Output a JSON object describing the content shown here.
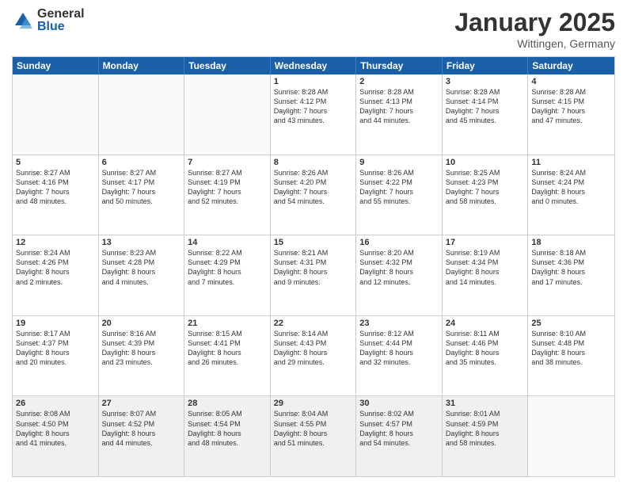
{
  "logo": {
    "general": "General",
    "blue": "Blue"
  },
  "title": "January 2025",
  "location": "Wittingen, Germany",
  "days": [
    "Sunday",
    "Monday",
    "Tuesday",
    "Wednesday",
    "Thursday",
    "Friday",
    "Saturday"
  ],
  "weeks": [
    [
      {
        "day": "",
        "info": ""
      },
      {
        "day": "",
        "info": ""
      },
      {
        "day": "",
        "info": ""
      },
      {
        "day": "1",
        "info": "Sunrise: 8:28 AM\nSunset: 4:12 PM\nDaylight: 7 hours\nand 43 minutes."
      },
      {
        "day": "2",
        "info": "Sunrise: 8:28 AM\nSunset: 4:13 PM\nDaylight: 7 hours\nand 44 minutes."
      },
      {
        "day": "3",
        "info": "Sunrise: 8:28 AM\nSunset: 4:14 PM\nDaylight: 7 hours\nand 45 minutes."
      },
      {
        "day": "4",
        "info": "Sunrise: 8:28 AM\nSunset: 4:15 PM\nDaylight: 7 hours\nand 47 minutes."
      }
    ],
    [
      {
        "day": "5",
        "info": "Sunrise: 8:27 AM\nSunset: 4:16 PM\nDaylight: 7 hours\nand 48 minutes."
      },
      {
        "day": "6",
        "info": "Sunrise: 8:27 AM\nSunset: 4:17 PM\nDaylight: 7 hours\nand 50 minutes."
      },
      {
        "day": "7",
        "info": "Sunrise: 8:27 AM\nSunset: 4:19 PM\nDaylight: 7 hours\nand 52 minutes."
      },
      {
        "day": "8",
        "info": "Sunrise: 8:26 AM\nSunset: 4:20 PM\nDaylight: 7 hours\nand 54 minutes."
      },
      {
        "day": "9",
        "info": "Sunrise: 8:26 AM\nSunset: 4:22 PM\nDaylight: 7 hours\nand 55 minutes."
      },
      {
        "day": "10",
        "info": "Sunrise: 8:25 AM\nSunset: 4:23 PM\nDaylight: 7 hours\nand 58 minutes."
      },
      {
        "day": "11",
        "info": "Sunrise: 8:24 AM\nSunset: 4:24 PM\nDaylight: 8 hours\nand 0 minutes."
      }
    ],
    [
      {
        "day": "12",
        "info": "Sunrise: 8:24 AM\nSunset: 4:26 PM\nDaylight: 8 hours\nand 2 minutes."
      },
      {
        "day": "13",
        "info": "Sunrise: 8:23 AM\nSunset: 4:28 PM\nDaylight: 8 hours\nand 4 minutes."
      },
      {
        "day": "14",
        "info": "Sunrise: 8:22 AM\nSunset: 4:29 PM\nDaylight: 8 hours\nand 7 minutes."
      },
      {
        "day": "15",
        "info": "Sunrise: 8:21 AM\nSunset: 4:31 PM\nDaylight: 8 hours\nand 9 minutes."
      },
      {
        "day": "16",
        "info": "Sunrise: 8:20 AM\nSunset: 4:32 PM\nDaylight: 8 hours\nand 12 minutes."
      },
      {
        "day": "17",
        "info": "Sunrise: 8:19 AM\nSunset: 4:34 PM\nDaylight: 8 hours\nand 14 minutes."
      },
      {
        "day": "18",
        "info": "Sunrise: 8:18 AM\nSunset: 4:36 PM\nDaylight: 8 hours\nand 17 minutes."
      }
    ],
    [
      {
        "day": "19",
        "info": "Sunrise: 8:17 AM\nSunset: 4:37 PM\nDaylight: 8 hours\nand 20 minutes."
      },
      {
        "day": "20",
        "info": "Sunrise: 8:16 AM\nSunset: 4:39 PM\nDaylight: 8 hours\nand 23 minutes."
      },
      {
        "day": "21",
        "info": "Sunrise: 8:15 AM\nSunset: 4:41 PM\nDaylight: 8 hours\nand 26 minutes."
      },
      {
        "day": "22",
        "info": "Sunrise: 8:14 AM\nSunset: 4:43 PM\nDaylight: 8 hours\nand 29 minutes."
      },
      {
        "day": "23",
        "info": "Sunrise: 8:12 AM\nSunset: 4:44 PM\nDaylight: 8 hours\nand 32 minutes."
      },
      {
        "day": "24",
        "info": "Sunrise: 8:11 AM\nSunset: 4:46 PM\nDaylight: 8 hours\nand 35 minutes."
      },
      {
        "day": "25",
        "info": "Sunrise: 8:10 AM\nSunset: 4:48 PM\nDaylight: 8 hours\nand 38 minutes."
      }
    ],
    [
      {
        "day": "26",
        "info": "Sunrise: 8:08 AM\nSunset: 4:50 PM\nDaylight: 8 hours\nand 41 minutes."
      },
      {
        "day": "27",
        "info": "Sunrise: 8:07 AM\nSunset: 4:52 PM\nDaylight: 8 hours\nand 44 minutes."
      },
      {
        "day": "28",
        "info": "Sunrise: 8:05 AM\nSunset: 4:54 PM\nDaylight: 8 hours\nand 48 minutes."
      },
      {
        "day": "29",
        "info": "Sunrise: 8:04 AM\nSunset: 4:55 PM\nDaylight: 8 hours\nand 51 minutes."
      },
      {
        "day": "30",
        "info": "Sunrise: 8:02 AM\nSunset: 4:57 PM\nDaylight: 8 hours\nand 54 minutes."
      },
      {
        "day": "31",
        "info": "Sunrise: 8:01 AM\nSunset: 4:59 PM\nDaylight: 8 hours\nand 58 minutes."
      },
      {
        "day": "",
        "info": ""
      }
    ]
  ]
}
